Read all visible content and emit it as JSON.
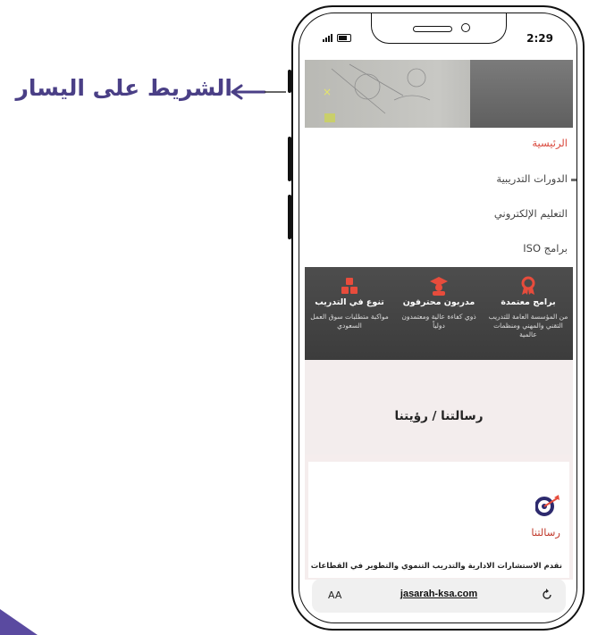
{
  "annotation": {
    "text": "الشريط على اليسار"
  },
  "status_bar": {
    "time": "2:29",
    "signal_icon": "signal-bars-icon",
    "battery_icon": "battery-icon"
  },
  "nav": {
    "items": [
      {
        "label": "الرئيسية",
        "active": true
      },
      {
        "label": "الدورات التدريبية",
        "active": false
      },
      {
        "label": "التعليم الإلكتروني",
        "active": false
      },
      {
        "label": "برامج ISO",
        "active": false
      }
    ]
  },
  "features": [
    {
      "icon": "blocks-icon",
      "title": "تنوع في التدريب",
      "desc": "مواكبة متطلبات سوق العمل السعودي"
    },
    {
      "icon": "graduate-icon",
      "title": "مدربون محترفون",
      "desc": "ذوي كفاءة عالية ومعتمدون دولياً"
    },
    {
      "icon": "award-icon",
      "title": "برامج معتمدة",
      "desc": "من المؤسسة العامة للتدريب التقني والمهني ومنظمات عالمية"
    }
  ],
  "mission": {
    "section_title": "رسالتنا / رؤيتنا",
    "subtitle": "رسالتنا",
    "text": "نقدم الاستشارات الادارية والتدريب التنموي والتطوير في القطاعات",
    "logo_icon": "target-arrow-icon"
  },
  "browser": {
    "aa_label": "AA",
    "url": "jasarah-ksa.com",
    "reload_icon": "reload-icon"
  },
  "colors": {
    "annotation": "#4a3f86",
    "accent_red": "#d9463a",
    "feature_icon": "#e74c3c",
    "band_dark": "#444444"
  }
}
